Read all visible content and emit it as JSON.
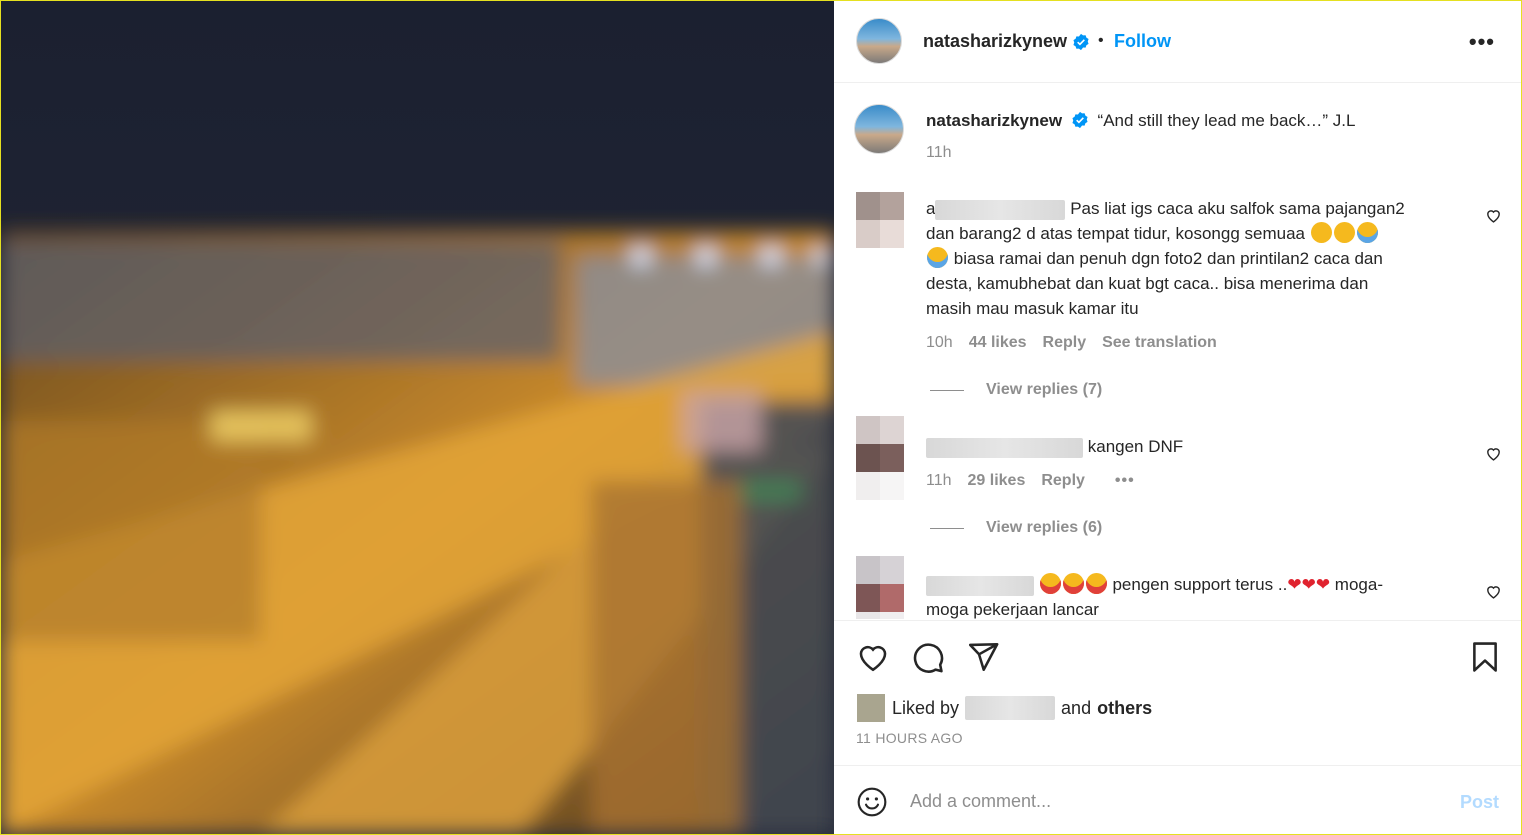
{
  "colors": {
    "accent": "#0095f6",
    "muted": "#8e8e8e",
    "text": "#262626",
    "post_disabled": "#b3dbff"
  },
  "header": {
    "username": "natasharizkynew",
    "separator": "•",
    "follow_label": "Follow",
    "more_icon": "more-horizontal-icon"
  },
  "caption": {
    "username": "natasharizkynew",
    "text": "“And still they lead me back…” J.L",
    "time": "11h"
  },
  "comments": [
    {
      "name_prefix": "a",
      "line1": "Pas liat igs caca aku salfok sama pajangan2",
      "line2": "dan barang2 d atas tempat tidur, kosongg semuaa",
      "line3": "biasa ramai dan penuh dgn foto2 dan printilan2 caca dan",
      "line4": "desta, kamubhebat dan kuat bgt caca.. bisa menerima dan",
      "line5": "masih mau masuk kamar itu",
      "time": "10h",
      "likes": "44 likes",
      "reply": "Reply",
      "translate": "See translation",
      "view_replies": "View replies (7)"
    },
    {
      "text": "kangen DNF",
      "time": "11h",
      "likes": "29 likes",
      "reply": "Reply",
      "more": "•••",
      "view_replies": "View replies (6)"
    },
    {
      "text_a": "pengen support terus ..",
      "text_b": "moga-",
      "line2": "moga pekerjaan lancar"
    }
  ],
  "actions": {
    "icons": [
      "heart-icon",
      "comment-icon",
      "share-icon",
      "bookmark-icon"
    ],
    "liked_by": "Liked by",
    "and": "and",
    "others": "others",
    "time_ago": "11 HOURS AGO"
  },
  "add_comment": {
    "placeholder": "Add a comment...",
    "post_label": "Post"
  }
}
